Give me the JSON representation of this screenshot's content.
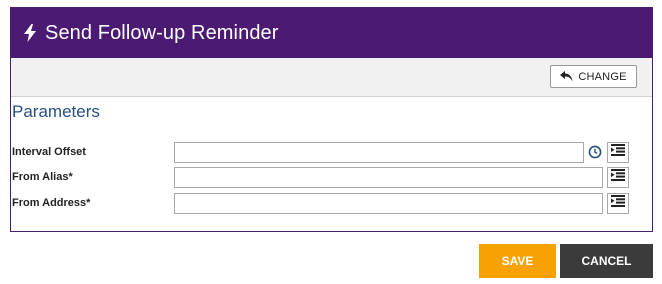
{
  "dialog": {
    "title": "Send Follow-up Reminder",
    "header_color": "#4b1b74",
    "header_icon": "lightning-bolt-icon"
  },
  "toolbar": {
    "change_label": "CHANGE",
    "change_icon": "undo-arrow-icon"
  },
  "parameters": {
    "section_title": "Parameters",
    "fields": [
      {
        "label": "Interval Offset",
        "value": "",
        "has_clock": true
      },
      {
        "label": "From Alias*",
        "value": ""
      },
      {
        "label": "From Address*",
        "value": ""
      }
    ]
  },
  "actions": {
    "save_label": "SAVE",
    "save_color": "#f7a103",
    "cancel_label": "CANCEL",
    "cancel_color": "#3b3b3b"
  }
}
